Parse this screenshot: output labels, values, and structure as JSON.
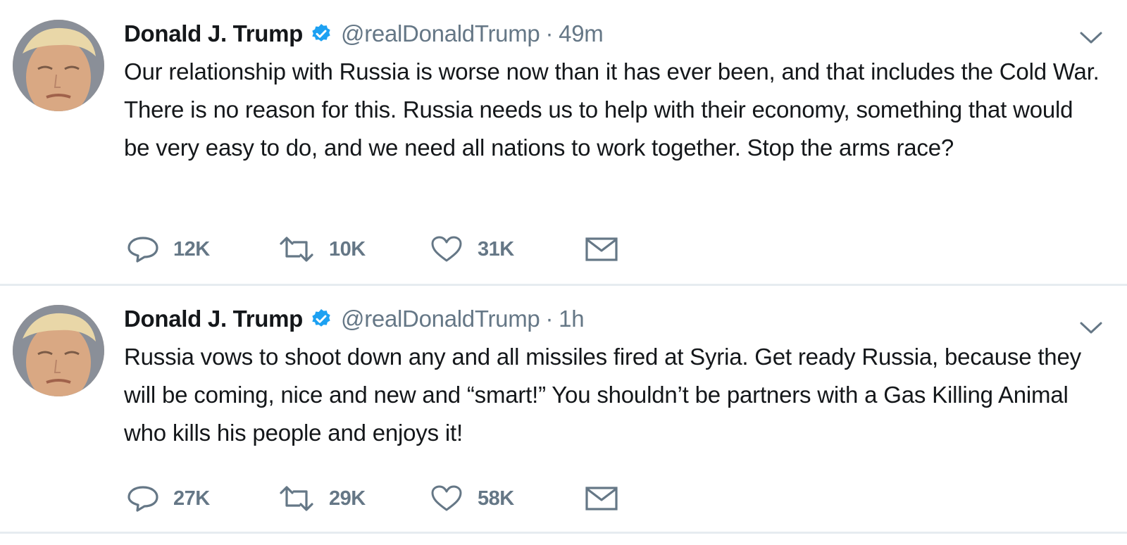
{
  "colors": {
    "text": "#14171a",
    "secondary": "#657786",
    "verified": "#1da1f2",
    "divider": "#e6ecf0"
  },
  "tweets": [
    {
      "author_name": "Donald J. Trump",
      "verified_icon": "verified-badge-icon",
      "handle": "@realDonaldTrump",
      "separator": "·",
      "time": "49m",
      "text": "Our relationship with Russia is worse now than it has ever been, and that includes the Cold War. There is no reason for this. Russia needs us to help with their economy, something that would be very easy to do, and we need all nations to work together. Stop the arms race?",
      "replies": "12K",
      "retweets": "10K",
      "likes": "31K"
    },
    {
      "author_name": "Donald J. Trump",
      "verified_icon": "verified-badge-icon",
      "handle": "@realDonaldTrump",
      "separator": "·",
      "time": "1h",
      "text": "Russia vows to shoot down any and all missiles fired at Syria. Get ready Russia, because they will be coming, nice and new and “smart!” You shouldn’t be partners with a Gas Killing Animal who kills his people and enjoys it!",
      "replies": "27K",
      "retweets": "29K",
      "likes": "58K"
    }
  ],
  "icons": {
    "reply": "reply-icon",
    "retweet": "retweet-icon",
    "like": "heart-icon",
    "message": "envelope-icon",
    "caret": "chevron-down-icon"
  }
}
